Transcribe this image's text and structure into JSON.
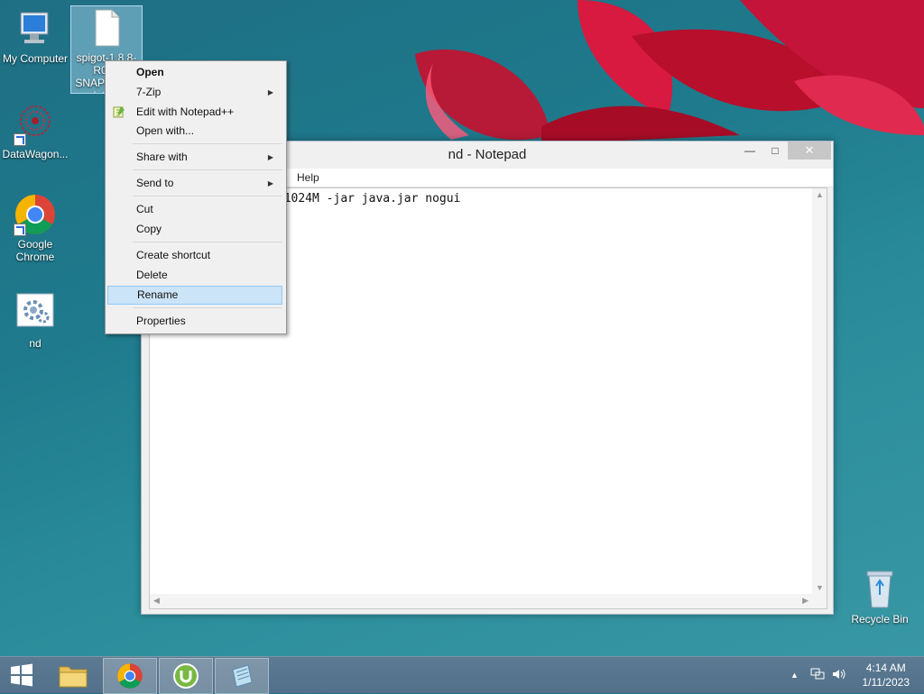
{
  "desktop": {
    "icons": [
      {
        "label": "My Computer"
      },
      {
        "label": "spigot-1.8.8-R0.1-SNAPSHOT-latest"
      },
      {
        "label": "DataWagon..."
      },
      {
        "label": "Google Chrome"
      },
      {
        "label": "nd"
      },
      {
        "label": "Recycle Bin"
      }
    ]
  },
  "notepad": {
    "title": "nd - Notepad",
    "menu": {
      "help": "Help"
    },
    "content": "java -Xmx1024M -Xms1024M -jar java.jar nogui",
    "buttons": {
      "minimize": "—",
      "maximize": "□",
      "close": "✕"
    }
  },
  "context_menu": {
    "items": [
      {
        "label": "Open"
      },
      {
        "label": "7-Zip"
      },
      {
        "label": "Edit with Notepad++"
      },
      {
        "label": "Open with..."
      },
      {
        "label": "Share with"
      },
      {
        "label": "Send to"
      },
      {
        "label": "Cut"
      },
      {
        "label": "Copy"
      },
      {
        "label": "Create shortcut"
      },
      {
        "label": "Delete"
      },
      {
        "label": "Rename"
      },
      {
        "label": "Properties"
      }
    ]
  },
  "taskbar": {
    "time": "4:14 AM",
    "date": "1/11/2023"
  },
  "colors": {
    "accent_highlight": "#cce4f7",
    "desktop_bg": "#1f7a8c",
    "taskbar": "#56748d"
  }
}
